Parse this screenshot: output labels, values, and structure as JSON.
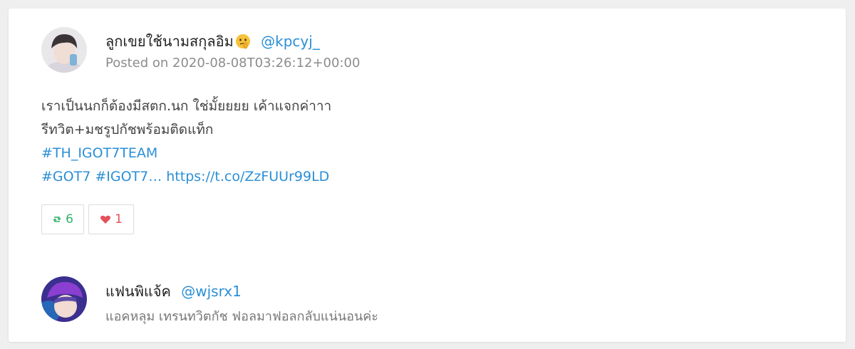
{
  "post": {
    "author_name": "ลูกเขยใช้นามสกุลอิม",
    "author_emoji": "shushing-face-emoji",
    "author_handle": "@kpcyj_",
    "posted_label": "Posted on 2020-08-08T03:26:12+00:00",
    "lines": [
      "เราเป็นนกก็ต้องมีสตก.นก ใช่มั้ยยยย เค้าแจกค่าาา",
      "รีทวิต+มชรูปกัชพร้อมติดแท็ก",
      "#TH_IGOT7TEAM"
    ],
    "last_line_tags": "#GOT7 #IGOT7…",
    "last_line_url": "https://t.co/ZzFUUr99LD",
    "retweet_count": "6",
    "like_count": "1"
  },
  "reply": {
    "author_name": "แฟนพิแจ้ค",
    "author_handle": "@wjsrx1",
    "text": "แอคหลุม เทรนทวิตกัช ฟอลมาฟอลกลับแน่นอนค่ะ"
  },
  "colors": {
    "link": "#2b8fd6",
    "retweet": "#2fb36b",
    "like": "#e5505a"
  }
}
